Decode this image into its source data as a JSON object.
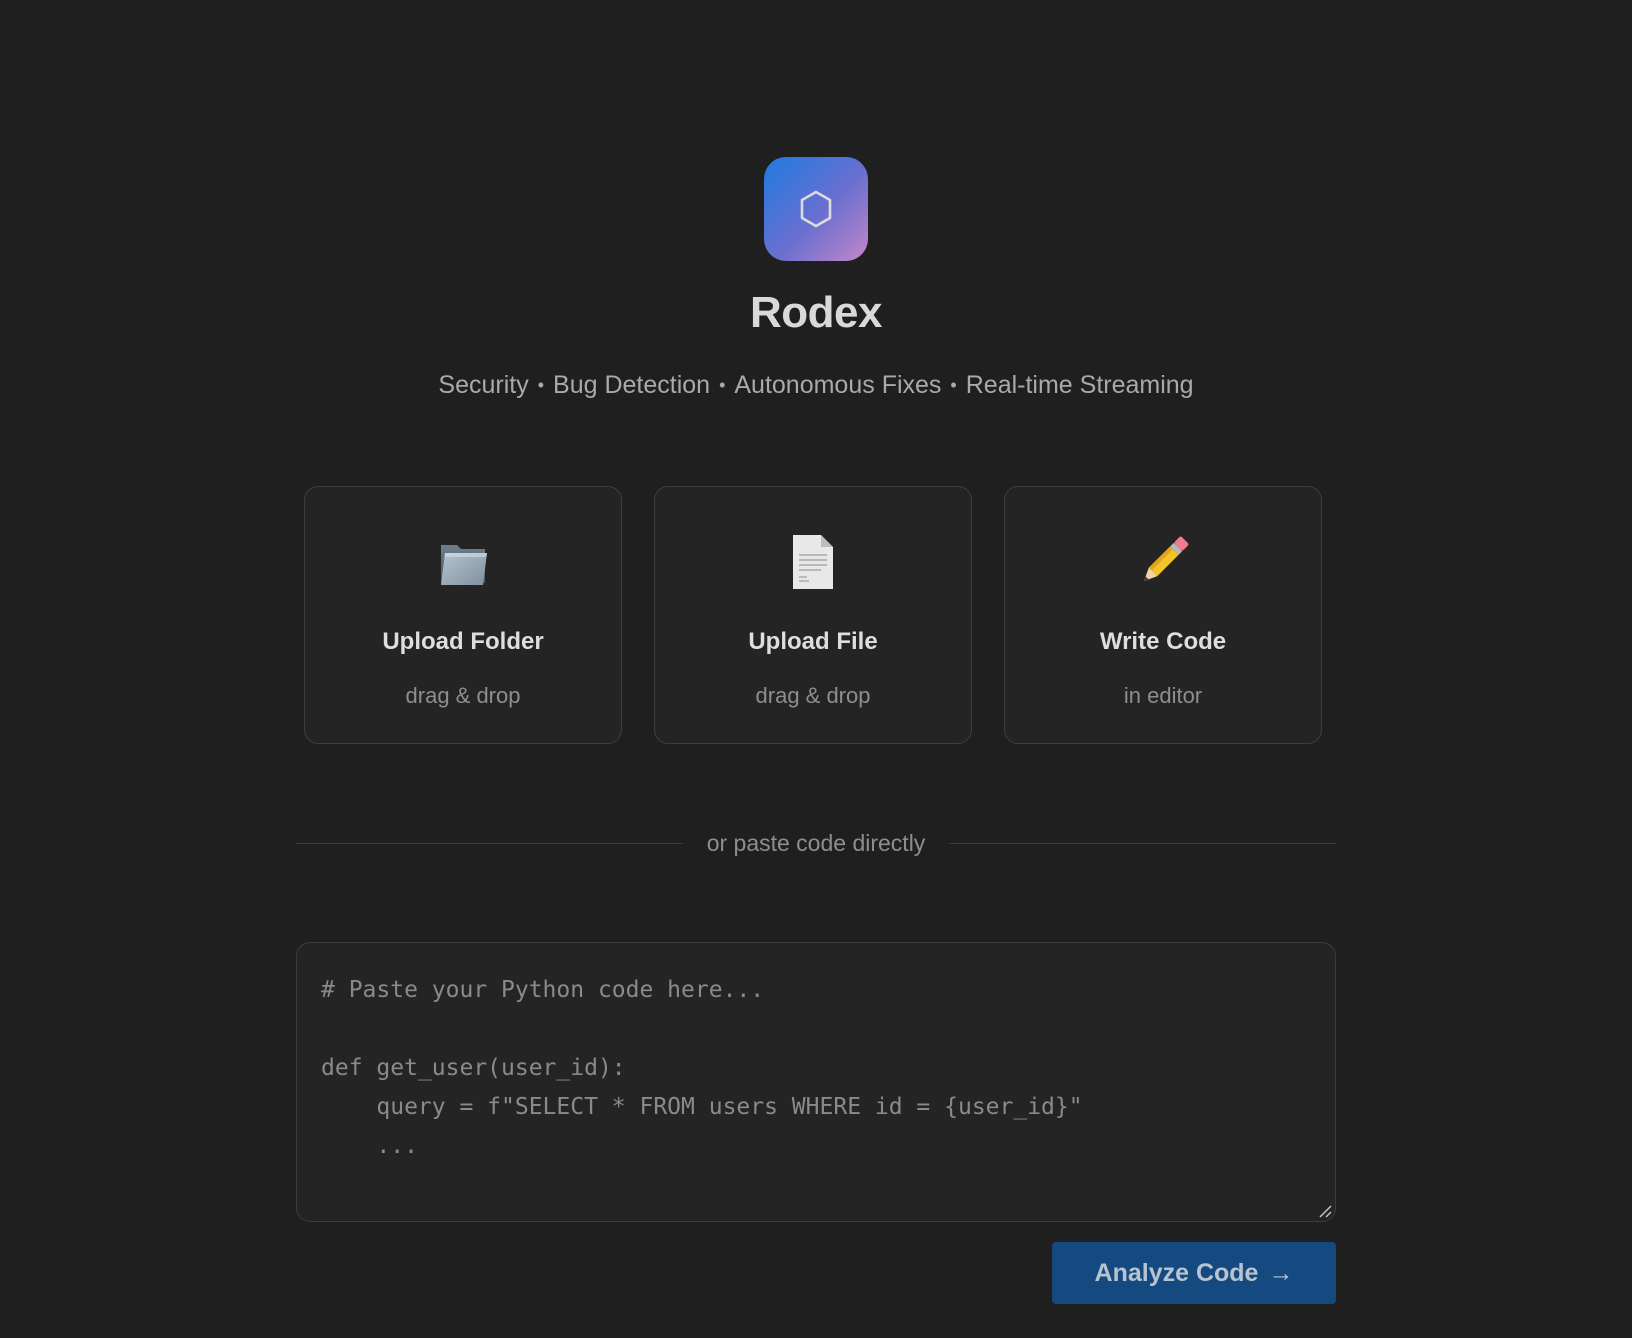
{
  "app": {
    "title": "Rodex",
    "logo_glyph": "⬡",
    "features": [
      "Security",
      "Bug Detection",
      "Autonomous Fixes",
      "Real-time Streaming"
    ],
    "separator": "•"
  },
  "cards": [
    {
      "label": "Upload Folder",
      "sub": "drag & drop",
      "icon": "folder-icon"
    },
    {
      "label": "Upload File",
      "sub": "drag & drop",
      "icon": "file-icon"
    },
    {
      "label": "Write Code",
      "sub": "in editor",
      "icon": "pencil-icon"
    }
  ],
  "divider": {
    "text": "or paste code directly"
  },
  "editor": {
    "placeholder": "# Paste your Python code here...\n\ndef get_user(user_id):\n    query = f\"SELECT * FROM users WHERE id = {user_id}\"\n    ..."
  },
  "analyze_button": {
    "label": "Analyze Code",
    "arrow": "→"
  },
  "colors": {
    "background": "#1f1f1f",
    "card_bg": "#242424",
    "button": "#154a80",
    "logo_gradient_start": "#1f7ae0",
    "logo_gradient_end": "#c487c9"
  }
}
